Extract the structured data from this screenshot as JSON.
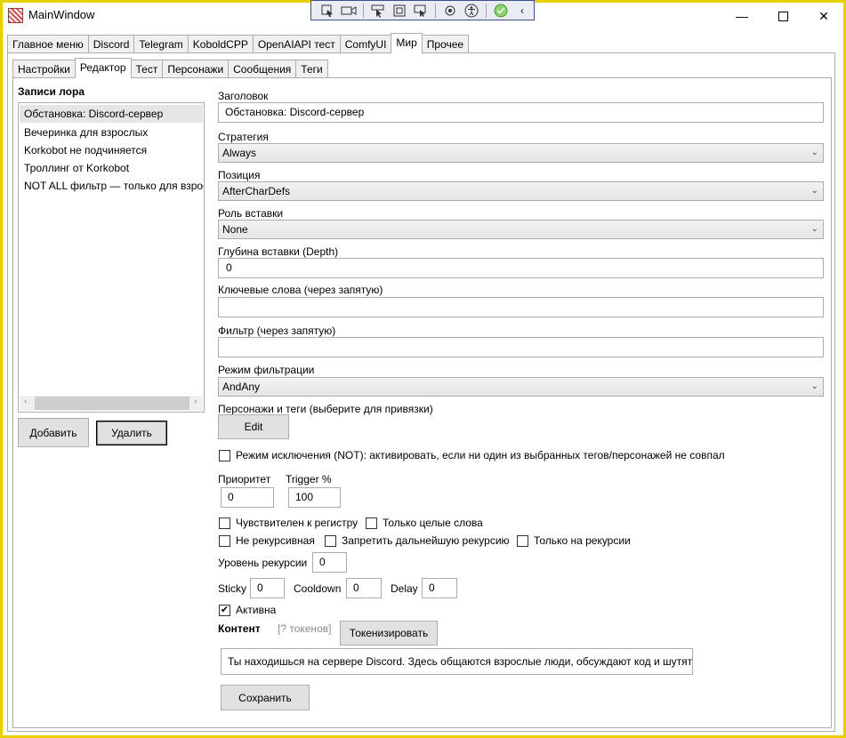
{
  "window": {
    "title": "MainWindow",
    "minimize": "—",
    "close": "✕"
  },
  "overlay_toolbar": {
    "icons": [
      "select-element-icon",
      "record-icon",
      "pointer-icon",
      "frame-icon",
      "track-icon",
      "hot-reload-icon",
      "accessibility-icon",
      "ok-icon",
      "collapse-icon"
    ],
    "collapse": "‹"
  },
  "top_tabs": [
    "Главное меню",
    "Discord",
    "Telegram",
    "KoboldCPP",
    "OpenAIAPI тест",
    "ComfyUI",
    "Мир",
    "Прочее"
  ],
  "top_tabs_active": "Мир",
  "sub_tabs": [
    "Настройки",
    "Редактор",
    "Тест",
    "Персонажи",
    "Сообщения",
    "Теги"
  ],
  "sub_tabs_active": "Редактор",
  "lore": {
    "heading": "Записи лора",
    "entries": [
      "Обстановка: Discord-сервер",
      "Вечеринка для взрослых",
      "Korkobot не подчиняется",
      "Троллинг от Korkobot",
      "NOT ALL фильтр — только для взрос"
    ],
    "scroll_left": "‹",
    "scroll_right": "›",
    "add_button": "Добавить",
    "delete_button": "Удалить"
  },
  "editor": {
    "title_label": "Заголовок",
    "title_value": "Обстановка: Discord-сервер",
    "strategy_label": "Стратегия",
    "strategy_value": "Always",
    "position_label": "Позиция",
    "position_value": "AfterCharDefs",
    "role_label": "Роль вставки",
    "role_value": "None",
    "depth_label": "Глубина вставки (Depth)",
    "depth_value": "0",
    "keywords_label": "Ключевые слова (через запятую)",
    "keywords_value": "",
    "filter_label": "Фильтр (через запятую)",
    "filter_value": "",
    "filter_mode_label": "Режим фильтрации",
    "filter_mode_value": "AndAny",
    "chars_tags_label": "Персонажи и теги (выберите для привязки)",
    "edit_button": "Edit",
    "exclude_mode_label": "Режим исключения (NOT): активировать, если ни один из выбранных тегов/персонажей не совпал",
    "priority_label": "Приоритет",
    "priority_value": "0",
    "trigger_label": "Trigger %",
    "trigger_value": "100",
    "case_sensitive_label": "Чувствителен к регистру",
    "whole_words_label": "Только целые слова",
    "non_recursive_label": "Не рекурсивная",
    "prevent_recursion_label": "Запретить дальнейшую рекурсию",
    "only_on_recursion_label": "Только на рекурсии",
    "recursion_level_label": "Уровень рекурсии",
    "recursion_level_value": "0",
    "sticky_label": "Sticky",
    "sticky_value": "0",
    "cooldown_label": "Cooldown",
    "cooldown_value": "0",
    "delay_label": "Delay",
    "delay_value": "0",
    "active_label": "Активна",
    "active_check": "✔",
    "content_label": "Контент",
    "tokens_label": "[? токенов]",
    "tokenize_button": "Токенизировать",
    "content_value": "Ты находишься на сервере Discord. Здесь общаются взрослые люди, обсуждают код и шутят.",
    "save_button": "Сохранить",
    "chevron": "⌄"
  }
}
